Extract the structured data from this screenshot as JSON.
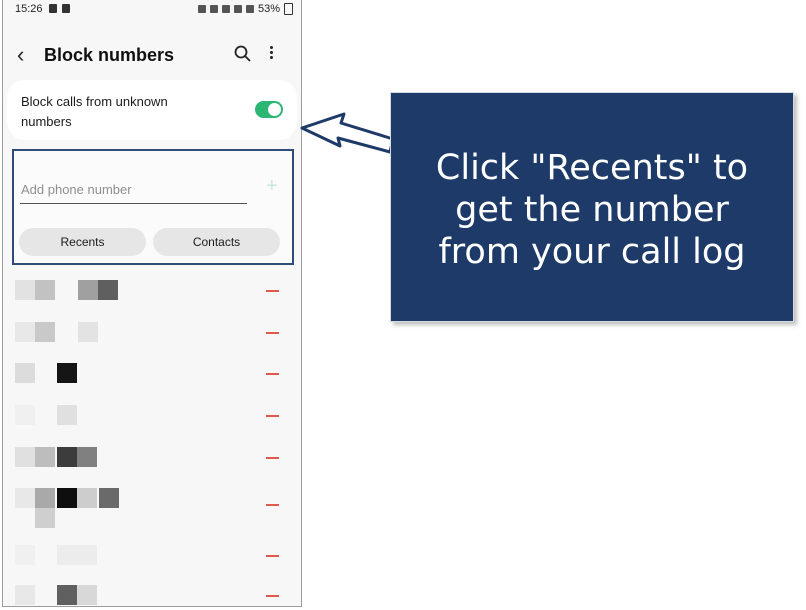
{
  "statusbar": {
    "time": "15:26",
    "battery": "53%"
  },
  "appbar": {
    "title": "Block numbers"
  },
  "block_unknown": {
    "label": "Block calls from unknown numbers",
    "enabled": true
  },
  "add_number": {
    "placeholder": "Add phone number",
    "recents_label": "Recents",
    "contacts_label": "Contacts"
  },
  "blocked_list": [
    {
      "id": "r1"
    },
    {
      "id": "r2"
    },
    {
      "id": "r3"
    },
    {
      "id": "r4"
    },
    {
      "id": "r5"
    },
    {
      "id": "r6"
    },
    {
      "id": "r7"
    },
    {
      "id": "r8"
    }
  ],
  "callout": {
    "line1": "Click \"Recents\" to",
    "line2": "get the number",
    "line3": "from your call log"
  },
  "colors": {
    "banner": "#1d3a69",
    "toggle_on": "#2bb673",
    "remove": "#e0594f",
    "highlight_border": "#2e4c7a"
  }
}
